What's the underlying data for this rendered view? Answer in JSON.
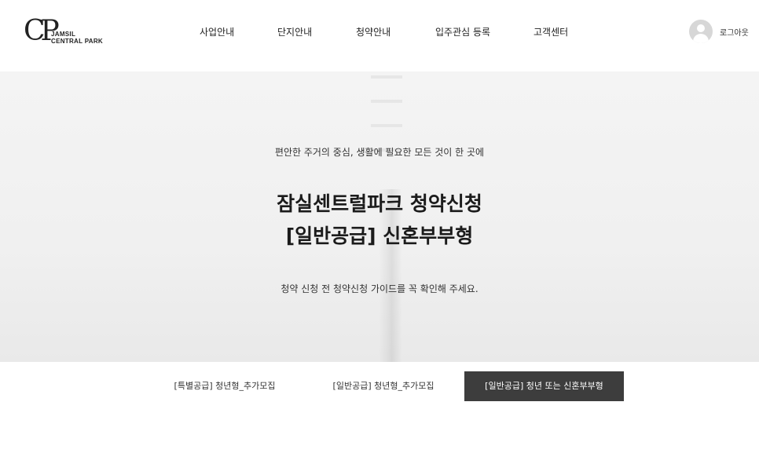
{
  "brand": {
    "logo_mark": "CP",
    "logo_line1": "JAMSIL",
    "logo_line2": "CENTRAL PARK"
  },
  "nav": {
    "items": [
      {
        "label": "사업안내"
      },
      {
        "label": "단지안내"
      },
      {
        "label": "청약안내"
      },
      {
        "label": "입주관심 등록"
      },
      {
        "label": "고객센터"
      }
    ]
  },
  "user": {
    "logout_label": "로그아웃",
    "avatar_icon": "user-avatar-icon"
  },
  "hero": {
    "subtitle": "편안한 주거의 중심, 생활에 필요한 모든 것이 한 곳에",
    "title_line1": "잠실센트럴파크 청약신청",
    "title_line2": "[일반공급] 신혼부부형",
    "note": "청약 신청 전 청약신청 가이드를 꼭 확인해 주세요."
  },
  "tabs": {
    "items": [
      {
        "label": "[특별공급] 청년형_추가모집",
        "active": false
      },
      {
        "label": "[일반공급] 청년형_추가모집",
        "active": false
      },
      {
        "label": "[일반공급] 청년 또는 신혼부부형",
        "active": true
      }
    ]
  },
  "colors": {
    "active_tab_bg": "#3d3d3d",
    "hero_bg": "#f2f2f2",
    "text": "#222222"
  }
}
